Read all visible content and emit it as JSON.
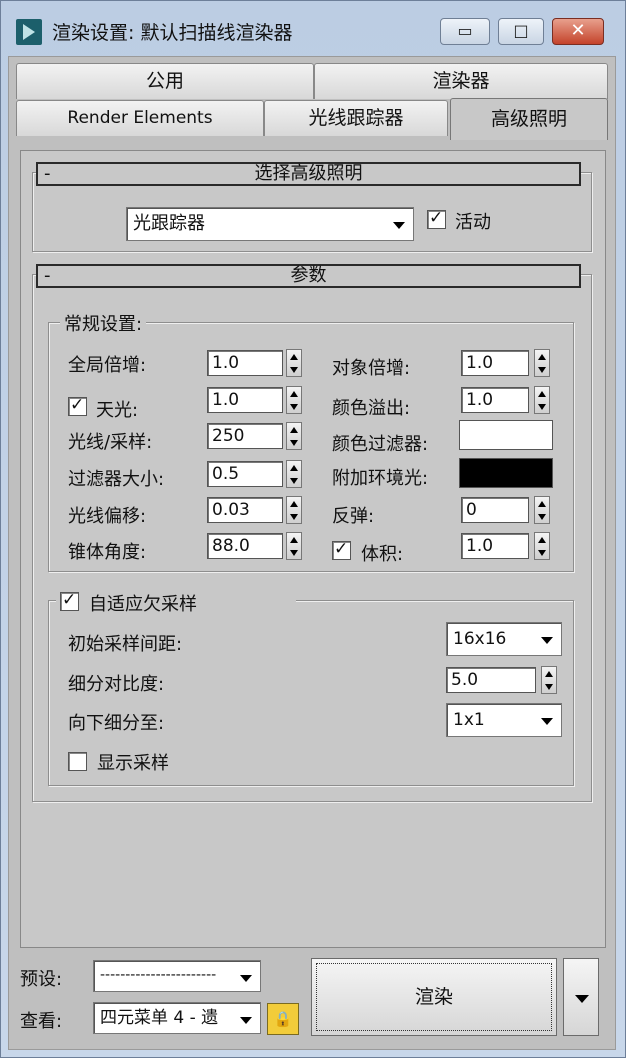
{
  "window": {
    "title": "渲染设置: 默认扫描线渲染器",
    "min_glyph": "▭",
    "max_glyph": "□",
    "close_glyph": "✕"
  },
  "tabs": {
    "row1": [
      "公用",
      "渲染器"
    ],
    "row2": [
      "Render Elements",
      "光线跟踪器",
      "高级照明"
    ],
    "active": "高级照明"
  },
  "select_panel": {
    "header": "选择高级照明",
    "collapse": "-",
    "plugin": "光跟踪器",
    "active_label": "活动",
    "active_checked": true
  },
  "params": {
    "header": "参数",
    "collapse": "-",
    "general_group": "常规设置:",
    "global_multiplier_label": "全局倍增:",
    "global_multiplier": "1.0",
    "object_multiplier_label": "对象倍增:",
    "object_multiplier": "1.0",
    "skylight_label": "天光:",
    "skylight_checked": true,
    "skylight": "1.0",
    "color_bleed_label": "颜色溢出:",
    "color_bleed": "1.0",
    "rays_label": "光线/采样:",
    "rays": "250",
    "color_filter_label": "颜色过滤器:",
    "color_filter_color": "#ffffff",
    "filter_size_label": "过滤器大小:",
    "filter_size": "0.5",
    "extra_ambient_label": "附加环境光:",
    "extra_ambient_color": "#000000",
    "ray_bias_label": "光线偏移:",
    "ray_bias": "0.03",
    "bounces_label": "反弹:",
    "bounces": "0",
    "cone_angle_label": "锥体角度:",
    "cone_angle": "88.0",
    "volume_label": "体积:",
    "volume_checked": true,
    "volume": "1.0"
  },
  "adaptive": {
    "label": "自适应欠采样",
    "checked": true,
    "initial_spacing_label": "初始采样间距:",
    "initial_spacing": "16x16",
    "subdiv_contrast_label": "细分对比度:",
    "subdiv_contrast": "5.0",
    "subdivide_down_label": "向下细分至:",
    "subdivide_down": "1x1",
    "show_samples_label": "显示采样",
    "show_samples_checked": false
  },
  "footer": {
    "preset_label": "预设:",
    "preset_value": "-----------------------",
    "view_label": "查看:",
    "view_value": "四元菜单 4 - 遗",
    "lock_glyph": "🔒",
    "render_label": "渲染"
  }
}
